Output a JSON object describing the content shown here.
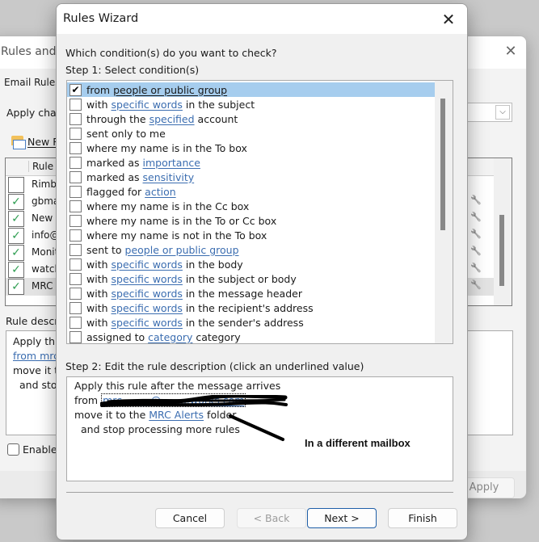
{
  "background_window": {
    "title": "Rules and Alerts",
    "tab": "Email Rules",
    "apply_changes_label": "Apply changes to this folder:",
    "new_rule_label": "New Rule...",
    "rules_column_header": "Rule (applied in the order shown)",
    "rules": [
      {
        "name": "Rimbey",
        "enabled": false
      },
      {
        "name": "gbmail",
        "enabled": true
      },
      {
        "name": "New V",
        "enabled": true
      },
      {
        "name": "info@a",
        "enabled": true
      },
      {
        "name": "Monitor",
        "enabled": true
      },
      {
        "name": "watch",
        "enabled": true
      },
      {
        "name": "MRC M",
        "enabled": true,
        "selected": true
      }
    ],
    "rule_description_label": "Rule description (click an underlined value to edit):",
    "rule_description_lines": [
      "Apply this rule after the message arrives",
      "from mrc",
      "move it to",
      "and stop processing more rules"
    ],
    "enable_label": "Enable rules on all messages downloaded from RSS Feeds",
    "apply_button": "Apply"
  },
  "wizard": {
    "title": "Rules Wizard",
    "question": "Which condition(s) do you want to check?",
    "step1_label": "Step 1: Select condition(s)",
    "conditions": [
      {
        "parts": [
          "from ",
          "people or public group",
          ""
        ],
        "checked": true,
        "selected": true
      },
      {
        "parts": [
          "with ",
          "specific words",
          " in the subject"
        ],
        "checked": false
      },
      {
        "parts": [
          "through the ",
          "specified",
          " account"
        ],
        "checked": false
      },
      {
        "parts": [
          "sent only to me",
          "",
          ""
        ],
        "checked": false
      },
      {
        "parts": [
          "where my name is in the To box",
          "",
          ""
        ],
        "checked": false
      },
      {
        "parts": [
          "marked as ",
          "importance",
          ""
        ],
        "checked": false
      },
      {
        "parts": [
          "marked as ",
          "sensitivity",
          ""
        ],
        "checked": false
      },
      {
        "parts": [
          "flagged for ",
          "action",
          ""
        ],
        "checked": false
      },
      {
        "parts": [
          "where my name is in the Cc box",
          "",
          ""
        ],
        "checked": false
      },
      {
        "parts": [
          "where my name is in the To or Cc box",
          "",
          ""
        ],
        "checked": false
      },
      {
        "parts": [
          "where my name is not in the To box",
          "",
          ""
        ],
        "checked": false
      },
      {
        "parts": [
          "sent to ",
          "people or public group",
          ""
        ],
        "checked": false
      },
      {
        "parts": [
          "with ",
          "specific words",
          " in the body"
        ],
        "checked": false
      },
      {
        "parts": [
          "with ",
          "specific words",
          " in the subject or body"
        ],
        "checked": false
      },
      {
        "parts": [
          "with ",
          "specific words",
          " in the message header"
        ],
        "checked": false
      },
      {
        "parts": [
          "with ",
          "specific words",
          " in the recipient's address"
        ],
        "checked": false
      },
      {
        "parts": [
          "with ",
          "specific words",
          " in the sender's address"
        ],
        "checked": false
      },
      {
        "parts": [
          "assigned to ",
          "category",
          " category"
        ],
        "checked": false
      }
    ],
    "step2_label": "Step 2: Edit the rule description (click an underlined value)",
    "description": {
      "line1": "Apply this rule after the message arrives",
      "line2_prefix": "from ",
      "line2_link": "mrc.........@.........works.com",
      "line3_prefix": "move it to the ",
      "line3_link": "MRC Alerts",
      "line3_suffix": " folder",
      "line4": "and stop processing more rules"
    },
    "annotation": "In a different mailbox",
    "buttons": {
      "cancel": "Cancel",
      "back": "< Back",
      "next": "Next >",
      "finish": "Finish"
    },
    "check_glyph": "✔",
    "close_glyph": "✕"
  }
}
